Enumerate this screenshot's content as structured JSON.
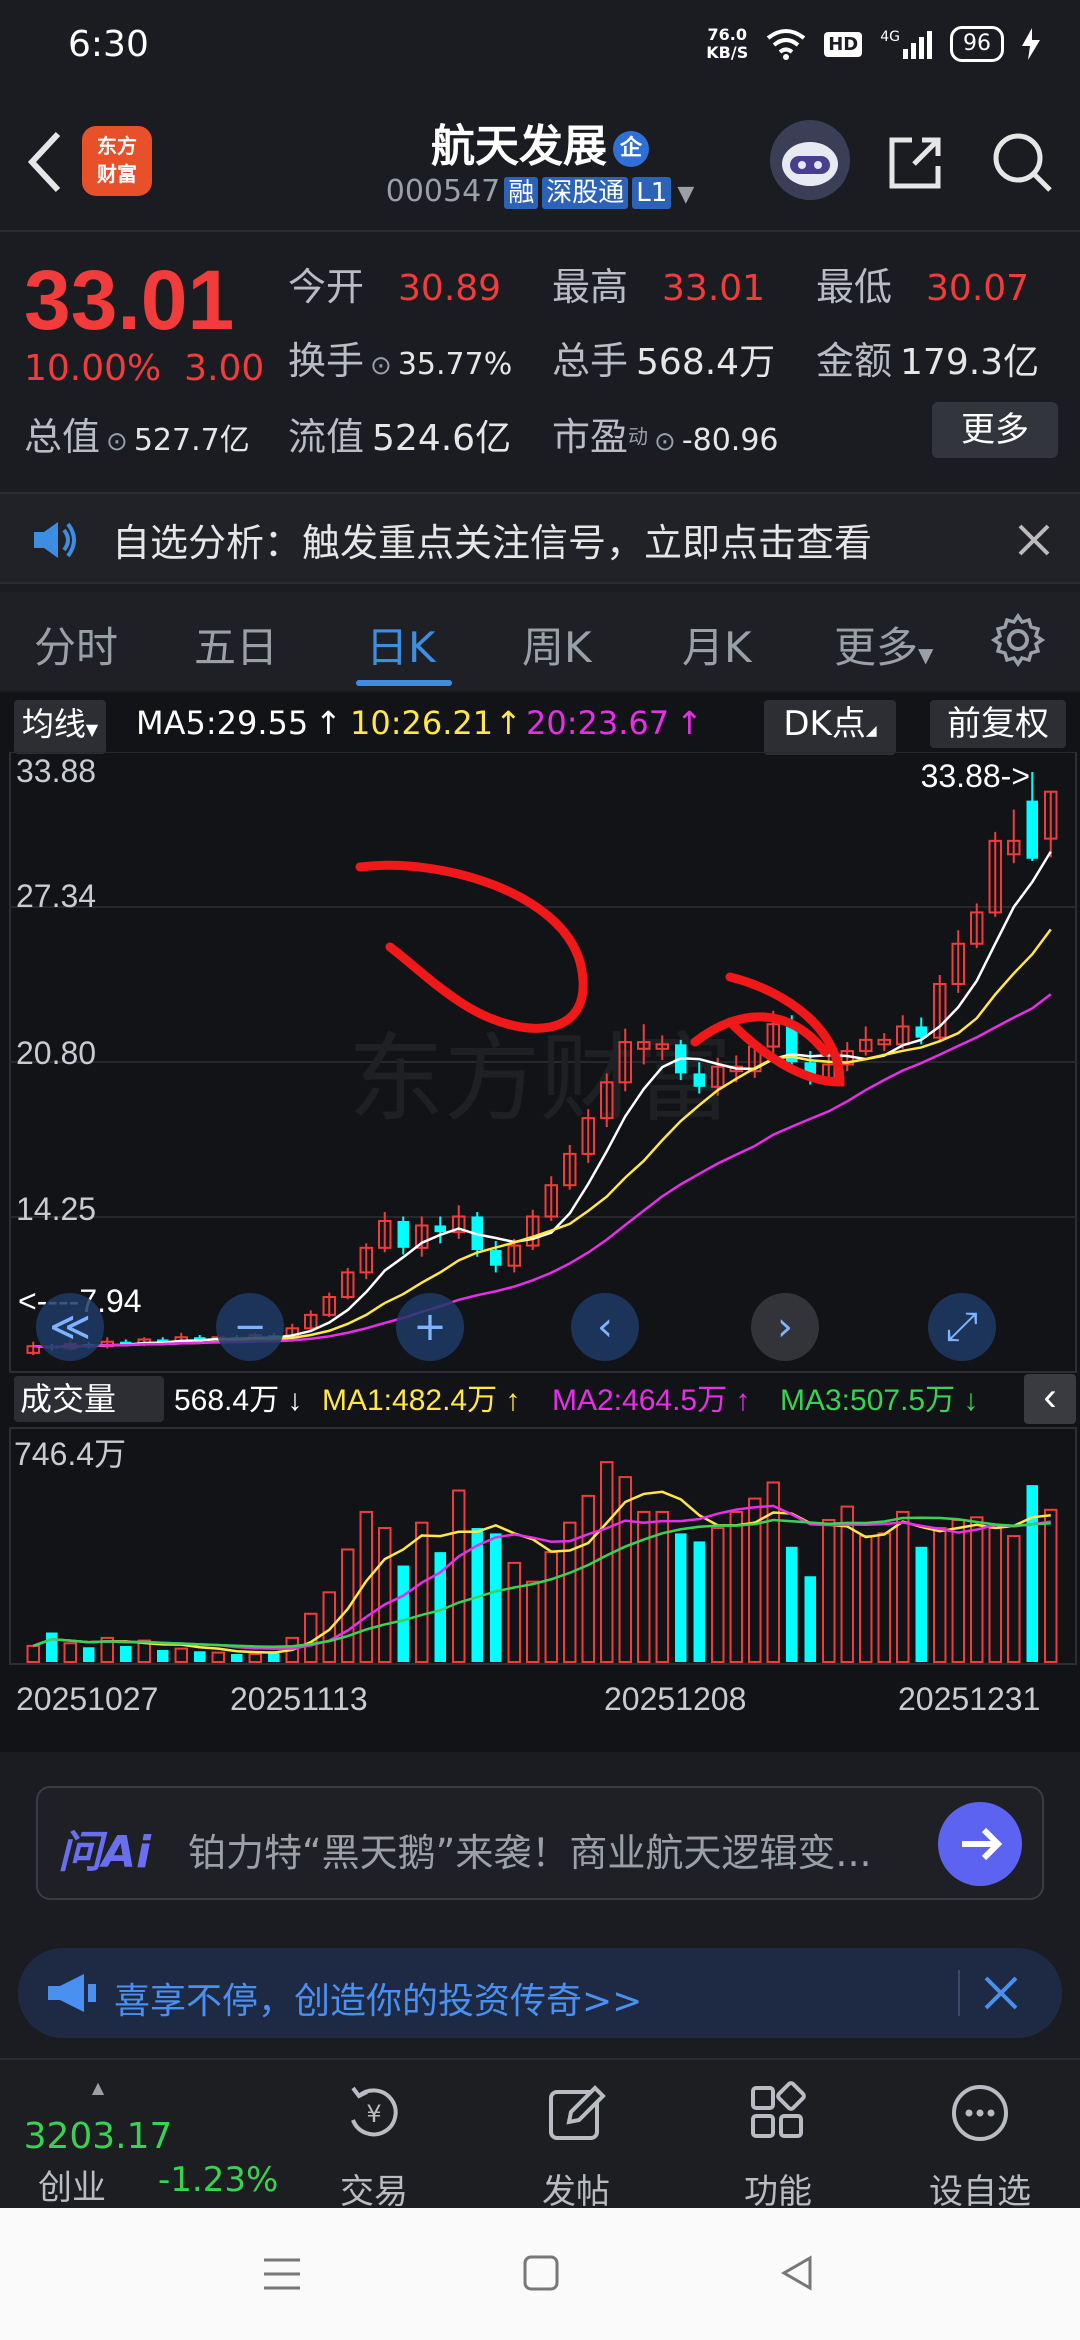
{
  "status": {
    "time": "6:30",
    "net_speed_top": "76.0",
    "net_speed_bot": "KB/S",
    "hd": "HD",
    "signal": "4G",
    "battery": "96"
  },
  "header": {
    "name": "航天发展",
    "qi_badge": "企",
    "code": "000547",
    "tags": [
      "融",
      "深股通",
      "L1"
    ],
    "logo_top": "东方",
    "logo_bot": "财富"
  },
  "quote": {
    "price": "33.01",
    "change_pct": "10.00%",
    "change_amt": "3.00",
    "fields": [
      {
        "label": "今开",
        "value": "30.89"
      },
      {
        "label": "最高",
        "value": "33.01"
      },
      {
        "label": "最低",
        "value": "30.07"
      },
      {
        "label": "换手",
        "value": "35.77%"
      },
      {
        "label": "总手",
        "value": "568.4万"
      },
      {
        "label": "金额",
        "value": "179.3亿"
      },
      {
        "label": "总值",
        "value": "527.7亿"
      },
      {
        "label": "流值",
        "value": "524.6亿"
      },
      {
        "label": "市盈",
        "value": "-80.96",
        "sup": "动"
      }
    ],
    "more": "更多"
  },
  "notice": {
    "text": "自选分析：触发重点关注信号，立即点击查看"
  },
  "tabs": {
    "items": [
      "分时",
      "五日",
      "日K",
      "周K",
      "月K",
      "更多"
    ],
    "active": "日K"
  },
  "indicators": {
    "ma_btn": "均线",
    "ma5": "MA5:29.55",
    "ma10": "10:26.21",
    "ma20": "20:23.67",
    "dk": "DK点",
    "fq": "前复权"
  },
  "kline": {
    "y_labels": [
      "33.88",
      "27.34",
      "20.80",
      "14.25"
    ],
    "max_label": "33.88->",
    "min_label": "<----7.94"
  },
  "volume": {
    "btn": "成交量",
    "vol": "568.4万",
    "ma1": "MA1:482.4万",
    "ma2": "MA2:464.5万",
    "ma3": "MA3:507.5万",
    "y_label": "746.4万",
    "dates": [
      "20251027",
      "20251113",
      "20251208",
      "20251231"
    ]
  },
  "ai": {
    "logo": "问Ai",
    "text": "铂力特“黑天鹅”来袭！商业航天逻辑变..."
  },
  "promo": {
    "text": "喜享不停，创造你的投资传奇>>"
  },
  "bottom_nav": {
    "index_value": "3203.17",
    "index_name": "创业",
    "index_change": "-1.23%",
    "items": [
      "交易",
      "发帖",
      "功能",
      "设自选"
    ]
  },
  "colors": {
    "up": "#f23c3c",
    "down_fill": "#00ffff",
    "accent": "#3d8de0",
    "ma5": "#ffffff",
    "ma10": "#ffe74a",
    "ma20": "#e62fe6",
    "green": "#39d353"
  },
  "chart_data": {
    "type": "candlestick",
    "price_axis": [
      7.94,
      33.88
    ],
    "candles": [
      {
        "o": 7.9,
        "c": 8.2,
        "h": 8.4,
        "l": 7.8,
        "up": true
      },
      {
        "o": 8.2,
        "c": 8.1,
        "h": 8.3,
        "l": 8.0,
        "up": false
      },
      {
        "o": 8.1,
        "c": 8.3,
        "h": 8.5,
        "l": 8.0,
        "up": true
      },
      {
        "o": 8.3,
        "c": 8.2,
        "h": 8.4,
        "l": 8.1,
        "up": false
      },
      {
        "o": 8.2,
        "c": 8.4,
        "h": 8.6,
        "l": 8.1,
        "up": true
      },
      {
        "o": 8.4,
        "c": 8.3,
        "h": 8.5,
        "l": 8.2,
        "up": false
      },
      {
        "o": 8.3,
        "c": 8.5,
        "h": 8.6,
        "l": 8.2,
        "up": true
      },
      {
        "o": 8.5,
        "c": 8.4,
        "h": 8.6,
        "l": 8.3,
        "up": false
      },
      {
        "o": 8.4,
        "c": 8.6,
        "h": 8.8,
        "l": 8.3,
        "up": true
      },
      {
        "o": 8.6,
        "c": 8.5,
        "h": 8.7,
        "l": 8.4,
        "up": false
      },
      {
        "o": 8.5,
        "c": 8.6,
        "h": 8.7,
        "l": 8.4,
        "up": true
      },
      {
        "o": 8.6,
        "c": 8.5,
        "h": 8.7,
        "l": 8.4,
        "up": false
      },
      {
        "o": 8.5,
        "c": 8.7,
        "h": 8.8,
        "l": 8.4,
        "up": true
      },
      {
        "o": 8.7,
        "c": 8.6,
        "h": 8.8,
        "l": 8.5,
        "up": false
      },
      {
        "o": 8.6,
        "c": 9.0,
        "h": 9.2,
        "l": 8.5,
        "up": true
      },
      {
        "o": 9.0,
        "c": 9.6,
        "h": 9.8,
        "l": 8.9,
        "up": true
      },
      {
        "o": 9.6,
        "c": 10.4,
        "h": 10.6,
        "l": 9.5,
        "up": true
      },
      {
        "o": 10.4,
        "c": 11.5,
        "h": 11.7,
        "l": 10.3,
        "up": true
      },
      {
        "o": 11.5,
        "c": 12.6,
        "h": 12.8,
        "l": 11.2,
        "up": true
      },
      {
        "o": 12.6,
        "c": 13.8,
        "h": 14.2,
        "l": 12.4,
        "up": true
      },
      {
        "o": 13.8,
        "c": 12.6,
        "h": 14.0,
        "l": 12.3,
        "up": false
      },
      {
        "o": 12.6,
        "c": 13.6,
        "h": 14.0,
        "l": 12.2,
        "up": true
      },
      {
        "o": 13.6,
        "c": 13.3,
        "h": 14.0,
        "l": 12.8,
        "up": false
      },
      {
        "o": 13.3,
        "c": 14.0,
        "h": 14.5,
        "l": 13.0,
        "up": true
      },
      {
        "o": 14.0,
        "c": 12.5,
        "h": 14.2,
        "l": 12.2,
        "up": false
      },
      {
        "o": 12.5,
        "c": 11.8,
        "h": 12.9,
        "l": 11.5,
        "up": false
      },
      {
        "o": 11.8,
        "c": 12.7,
        "h": 13.0,
        "l": 11.5,
        "up": true
      },
      {
        "o": 12.7,
        "c": 14.0,
        "h": 14.3,
        "l": 12.5,
        "up": true
      },
      {
        "o": 14.0,
        "c": 15.4,
        "h": 15.8,
        "l": 13.8,
        "up": true
      },
      {
        "o": 15.4,
        "c": 16.8,
        "h": 17.2,
        "l": 15.2,
        "up": true
      },
      {
        "o": 16.8,
        "c": 18.4,
        "h": 18.8,
        "l": 16.4,
        "up": true
      },
      {
        "o": 18.4,
        "c": 20.0,
        "h": 20.4,
        "l": 18.0,
        "up": true
      },
      {
        "o": 20.0,
        "c": 21.8,
        "h": 22.4,
        "l": 19.6,
        "up": true
      },
      {
        "o": 21.8,
        "c": 21.5,
        "h": 22.6,
        "l": 20.8,
        "up": true
      },
      {
        "o": 21.5,
        "c": 21.7,
        "h": 22.1,
        "l": 21.0,
        "up": true
      },
      {
        "o": 21.7,
        "c": 20.4,
        "h": 21.9,
        "l": 20.1,
        "up": false
      },
      {
        "o": 20.4,
        "c": 19.8,
        "h": 20.9,
        "l": 19.5,
        "up": false
      },
      {
        "o": 19.8,
        "c": 20.7,
        "h": 21.1,
        "l": 19.4,
        "up": true
      },
      {
        "o": 20.7,
        "c": 20.5,
        "h": 21.2,
        "l": 20.0,
        "up": true
      },
      {
        "o": 20.5,
        "c": 21.6,
        "h": 21.9,
        "l": 20.2,
        "up": true
      },
      {
        "o": 21.6,
        "c": 22.6,
        "h": 23.2,
        "l": 21.2,
        "up": true
      },
      {
        "o": 22.6,
        "c": 20.9,
        "h": 23.0,
        "l": 20.5,
        "up": false
      },
      {
        "o": 20.9,
        "c": 20.2,
        "h": 21.4,
        "l": 19.9,
        "up": false
      },
      {
        "o": 20.2,
        "c": 20.8,
        "h": 21.3,
        "l": 19.9,
        "up": true
      },
      {
        "o": 20.8,
        "c": 21.4,
        "h": 21.8,
        "l": 20.5,
        "up": true
      },
      {
        "o": 21.4,
        "c": 21.9,
        "h": 22.5,
        "l": 21.2,
        "up": true
      },
      {
        "o": 21.9,
        "c": 21.7,
        "h": 22.2,
        "l": 21.4,
        "up": true
      },
      {
        "o": 21.7,
        "c": 22.5,
        "h": 23.0,
        "l": 21.5,
        "up": true
      },
      {
        "o": 22.5,
        "c": 22.0,
        "h": 22.9,
        "l": 21.7,
        "up": false
      },
      {
        "o": 22.0,
        "c": 24.4,
        "h": 24.8,
        "l": 21.8,
        "up": true
      },
      {
        "o": 24.4,
        "c": 26.2,
        "h": 26.8,
        "l": 24.0,
        "up": true
      },
      {
        "o": 26.2,
        "c": 27.6,
        "h": 28.0,
        "l": 26.0,
        "up": true
      },
      {
        "o": 27.6,
        "c": 30.8,
        "h": 31.2,
        "l": 27.4,
        "up": true
      },
      {
        "o": 30.8,
        "c": 30.2,
        "h": 32.2,
        "l": 29.8,
        "up": true
      },
      {
        "o": 32.6,
        "c": 30.0,
        "h": 33.88,
        "l": 29.9,
        "up": false
      },
      {
        "o": 30.9,
        "c": 33.0,
        "h": 33.01,
        "l": 30.07,
        "up": true
      }
    ],
    "volume": [
      {
        "v": 60,
        "up": true
      },
      {
        "v": 110,
        "up": false
      },
      {
        "v": 70,
        "up": true
      },
      {
        "v": 55,
        "up": false
      },
      {
        "v": 90,
        "up": true
      },
      {
        "v": 60,
        "up": false
      },
      {
        "v": 80,
        "up": true
      },
      {
        "v": 45,
        "up": false
      },
      {
        "v": 50,
        "up": true
      },
      {
        "v": 40,
        "up": false
      },
      {
        "v": 35,
        "up": true
      },
      {
        "v": 30,
        "up": false
      },
      {
        "v": 30,
        "up": true
      },
      {
        "v": 40,
        "up": false
      },
      {
        "v": 90,
        "up": true
      },
      {
        "v": 180,
        "up": true
      },
      {
        "v": 260,
        "up": true
      },
      {
        "v": 420,
        "up": true
      },
      {
        "v": 560,
        "up": true
      },
      {
        "v": 500,
        "up": true
      },
      {
        "v": 360,
        "up": false
      },
      {
        "v": 520,
        "up": true
      },
      {
        "v": 410,
        "up": false
      },
      {
        "v": 640,
        "up": true
      },
      {
        "v": 500,
        "up": false
      },
      {
        "v": 480,
        "up": false
      },
      {
        "v": 370,
        "up": true
      },
      {
        "v": 300,
        "up": true
      },
      {
        "v": 410,
        "up": true
      },
      {
        "v": 520,
        "up": true
      },
      {
        "v": 620,
        "up": true
      },
      {
        "v": 746,
        "up": true
      },
      {
        "v": 690,
        "up": true
      },
      {
        "v": 560,
        "up": true
      },
      {
        "v": 560,
        "up": true
      },
      {
        "v": 480,
        "up": false
      },
      {
        "v": 450,
        "up": false
      },
      {
        "v": 500,
        "up": true
      },
      {
        "v": 560,
        "up": true
      },
      {
        "v": 610,
        "up": true
      },
      {
        "v": 670,
        "up": true
      },
      {
        "v": 430,
        "up": false
      },
      {
        "v": 320,
        "up": false
      },
      {
        "v": 530,
        "up": true
      },
      {
        "v": 580,
        "up": true
      },
      {
        "v": 470,
        "up": true
      },
      {
        "v": 480,
        "up": true
      },
      {
        "v": 560,
        "up": true
      },
      {
        "v": 430,
        "up": false
      },
      {
        "v": 500,
        "up": true
      },
      {
        "v": 530,
        "up": true
      },
      {
        "v": 540,
        "up": true
      },
      {
        "v": 500,
        "up": true
      },
      {
        "v": 470,
        "up": true
      },
      {
        "v": 660,
        "up": false
      },
      {
        "v": 568,
        "up": true
      }
    ]
  }
}
